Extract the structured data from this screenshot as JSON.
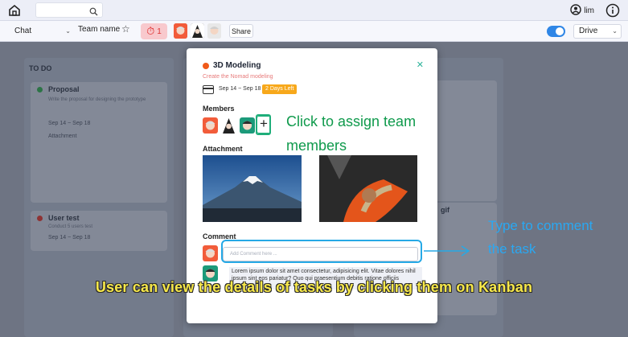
{
  "topnav": {
    "user_name": "lim"
  },
  "toolbar": {
    "chat_select": "Chat",
    "team_name": "Team name",
    "timer_count": "1",
    "share_label": "Share",
    "drive_select": "Drive"
  },
  "board": {
    "todo_title": "TO DO",
    "cards": [
      {
        "title": "Proposal",
        "subtitle": "Write the proposal for designing the prototype",
        "dates": "Sep 14 ~ Sep 18",
        "attachment": "Attachment"
      },
      {
        "title": "User test",
        "subtitle": "Conduct 5 users test",
        "dates": "Sep 14 ~ Sep 18"
      }
    ],
    "right_card_fragment": "gif"
  },
  "modal": {
    "title": "3D Modeling",
    "subtitle": "Create the Nomad modeling",
    "dates": "Sep 14 ~ Sep 18",
    "badge": "2 Days Left",
    "members_label": "Members",
    "attachment_label": "Attachment",
    "comment_label": "Comment",
    "comment_placeholder": "Add Comment here ...",
    "comment_text": "Lorem ipsum dolor sit amet consectetur, adipisicing elit. Vitae dolores nihil ipsum sint eos pariatur? Quo qui praesentium debitis ratione officiis"
  },
  "annotations": {
    "assign": "Click to assign team members",
    "comment": "Type to comment the task",
    "caption": "User can view the details of tasks by clicking them on Kanban"
  },
  "colors": {
    "accent_green": "#1fae7a",
    "accent_blue": "#26a9e6",
    "badge_orange": "#f7a81b",
    "caption_yellow": "#f7e84a"
  }
}
